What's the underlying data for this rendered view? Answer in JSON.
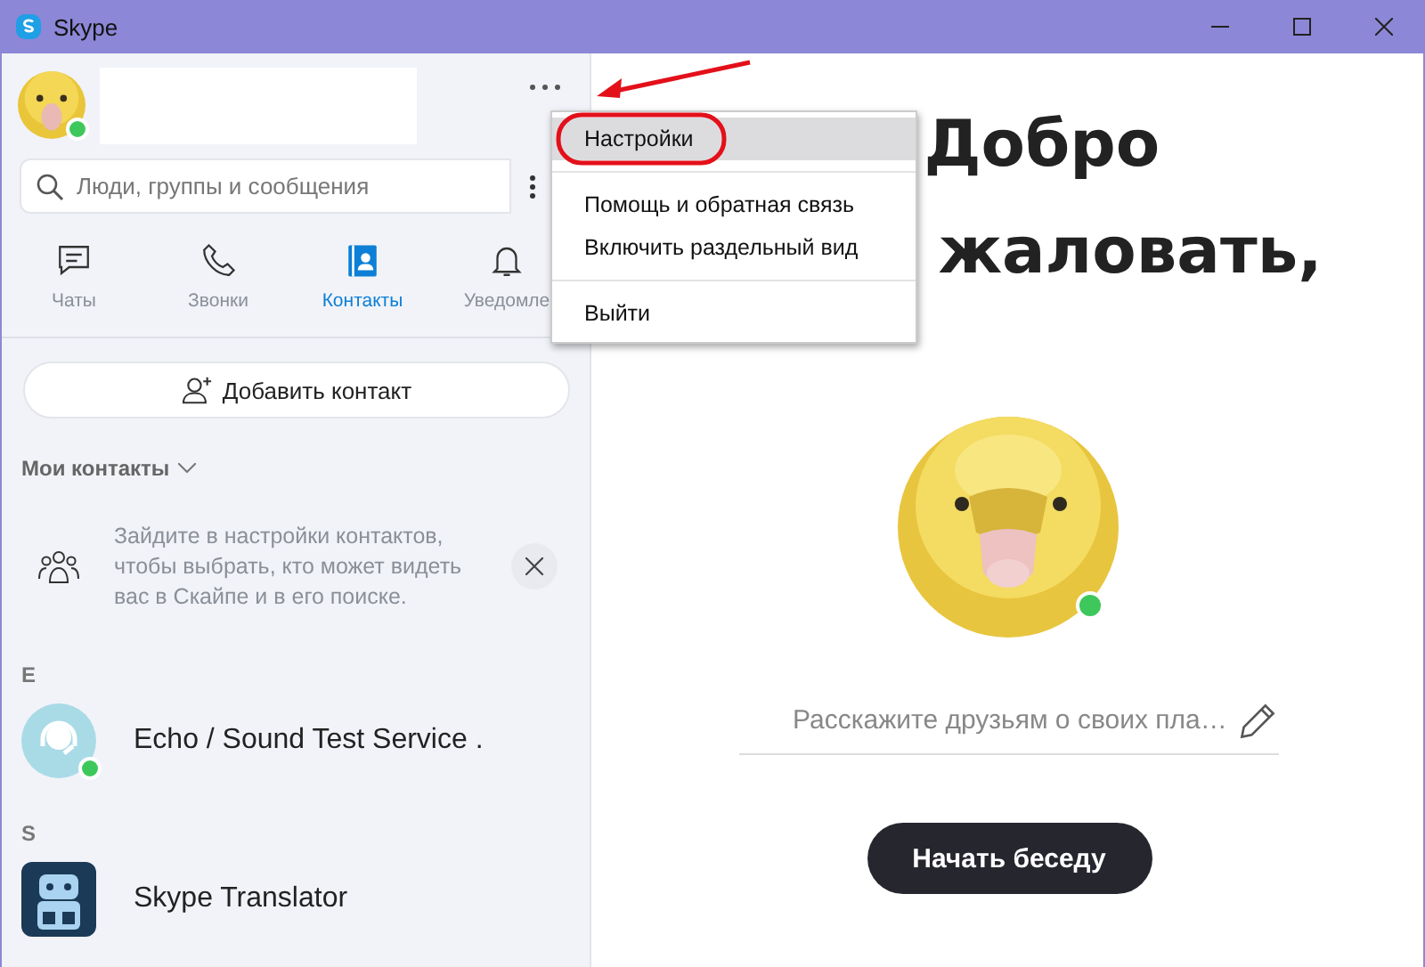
{
  "window": {
    "title": "Skype"
  },
  "profile": {
    "online": true
  },
  "search": {
    "placeholder": "Люди, группы и сообщения"
  },
  "tabs": [
    {
      "label": "Чаты",
      "kind": "chat",
      "selected": false
    },
    {
      "label": "Звонки",
      "kind": "call",
      "selected": false
    },
    {
      "label": "Контакты",
      "kind": "contacts",
      "selected": true
    },
    {
      "label": "Уведомле",
      "kind": "bell",
      "selected": false
    }
  ],
  "add_contact": "Добавить контакт",
  "contacts_header": "Мои контакты",
  "notice": "Зайдите в настройки контактов, чтобы выбрать, кто может видеть вас в Скайпе и в его поиске.",
  "contact_groups": [
    {
      "letter": "E",
      "contacts": [
        {
          "name": "Echo / Sound Test Service .",
          "kind": "echo",
          "online": true
        }
      ]
    },
    {
      "letter": "S",
      "contacts": [
        {
          "name": "Skype Translator",
          "kind": "translator"
        }
      ]
    }
  ],
  "welcome": {
    "lines": [
      "Добро",
      "жаловать,"
    ]
  },
  "mood": {
    "placeholder": "Расскажите друзьям о своих пла…"
  },
  "start_button": "Начать беседу",
  "menu": {
    "groups": [
      [
        {
          "label": "Настройки",
          "selected": true
        }
      ],
      [
        {
          "label": "Помощь и обратная связь",
          "selected": false
        },
        {
          "label": "Включить раздельный вид",
          "selected": false
        }
      ],
      [
        {
          "label": "Выйти",
          "selected": false
        }
      ]
    ]
  }
}
